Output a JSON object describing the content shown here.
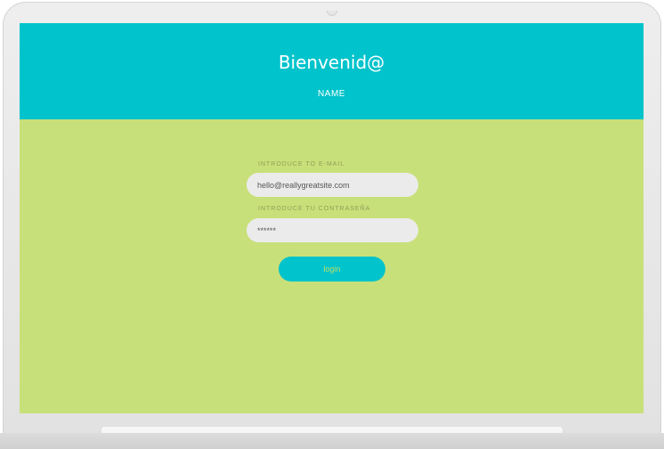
{
  "header": {
    "title": "Bienvenid@",
    "subtitle": "NAME"
  },
  "form": {
    "email_label": "INTRODUCE TO E-MAIL",
    "email_value": "hello@reallygreatsite.com",
    "password_label": "INTRODUCE TU CONTRASEÑA",
    "password_value": "******",
    "login_label": "login"
  },
  "colors": {
    "header_bg": "#00c3cb",
    "body_bg": "#c8e079",
    "field_bg": "#ebebeb",
    "button_bg": "#00c3cb",
    "button_text": "#b9e06a"
  }
}
